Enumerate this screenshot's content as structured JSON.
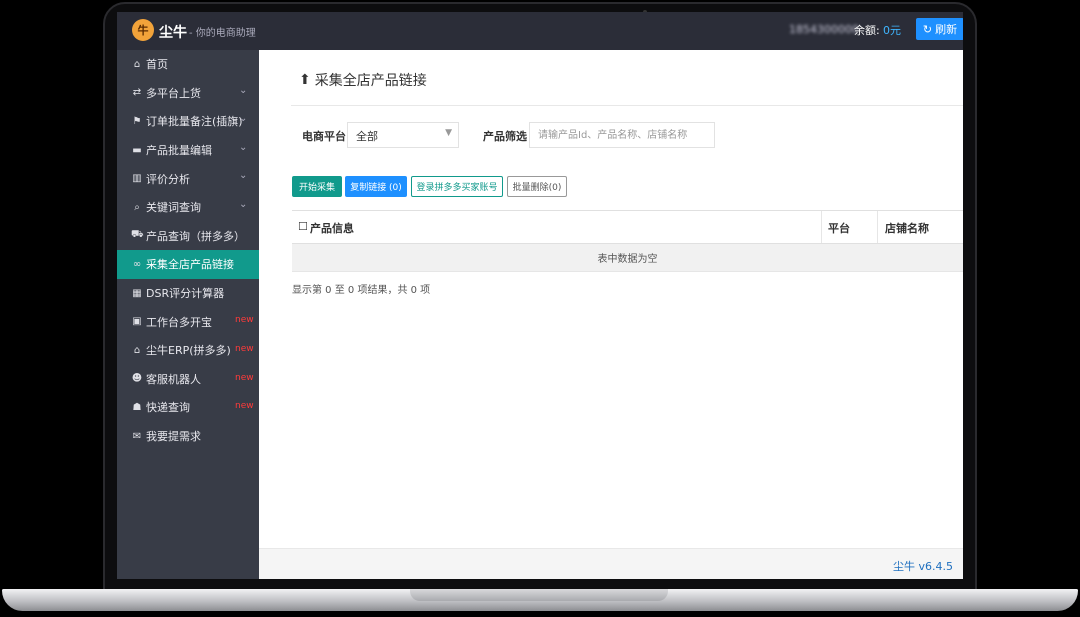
{
  "header": {
    "app_name": "尘牛",
    "logo_glyph": "牛",
    "tagline": "- 你的电商助理",
    "account_masked": "1854300000",
    "balance_label": "余额:",
    "balance_value": "0元",
    "refresh_label": "刷新"
  },
  "sidebar": {
    "items": [
      {
        "label": "首页",
        "icon": "home-icon",
        "glyph": "⌂"
      },
      {
        "label": "多平台上货",
        "icon": "share-icon",
        "glyph": "⇄",
        "chevron": true
      },
      {
        "label": "订单批量备注(插旗)",
        "icon": "flag-icon",
        "glyph": "⚑",
        "chevron": true
      },
      {
        "label": "产品批量编辑",
        "icon": "bed-icon",
        "glyph": "▬",
        "chevron": true
      },
      {
        "label": "评价分析",
        "icon": "bar-chart-icon",
        "glyph": "▥",
        "chevron": true
      },
      {
        "label": "关键词查询",
        "icon": "search-icon",
        "glyph": "⌕",
        "chevron": true
      },
      {
        "label": "产品查询（拼多多）",
        "icon": "truck-icon",
        "glyph": "⛟"
      },
      {
        "label": "采集全店产品链接",
        "icon": "link-icon",
        "glyph": "∞",
        "active": true
      },
      {
        "label": "DSR评分计算器",
        "icon": "calculator-icon",
        "glyph": "▦"
      },
      {
        "label": "工作台多开宝",
        "icon": "briefcase-icon",
        "glyph": "▣",
        "badge": "new"
      },
      {
        "label": "尘牛ERP(拼多多)",
        "icon": "bank-icon",
        "glyph": "⌂",
        "badge": "new"
      },
      {
        "label": "客服机器人",
        "icon": "robot-icon",
        "glyph": "☻",
        "badge": "new"
      },
      {
        "label": "快递查询",
        "icon": "user-secret-icon",
        "glyph": "☗",
        "badge": "new"
      },
      {
        "label": "我要提需求",
        "icon": "envelope-icon",
        "glyph": "✉"
      }
    ]
  },
  "main": {
    "title": "采集全店产品链接",
    "platform_label": "电商平台",
    "platform_value": "全部",
    "filter_label": "产品筛选",
    "filter_placeholder": "请输产品Id、产品名称、店铺名称",
    "buttons": {
      "start": "开始采集",
      "copy": "复制链接 (0)",
      "login": "登录拼多多买家账号",
      "batch_delete": "批量删除(0)"
    },
    "table": {
      "columns": [
        "产品信息",
        "平台",
        "店铺名称"
      ],
      "empty_text": "表中数据为空"
    },
    "summary": "显示第 0 至 0 项结果，共 0 项",
    "version": "尘牛 v6.4.5"
  },
  "colors": {
    "topbar": "#2b2d38",
    "sidebar": "#383c47",
    "accent_teal": "#119a8c",
    "accent_blue": "#1e90ff",
    "badge_red": "#ff3b3b"
  }
}
